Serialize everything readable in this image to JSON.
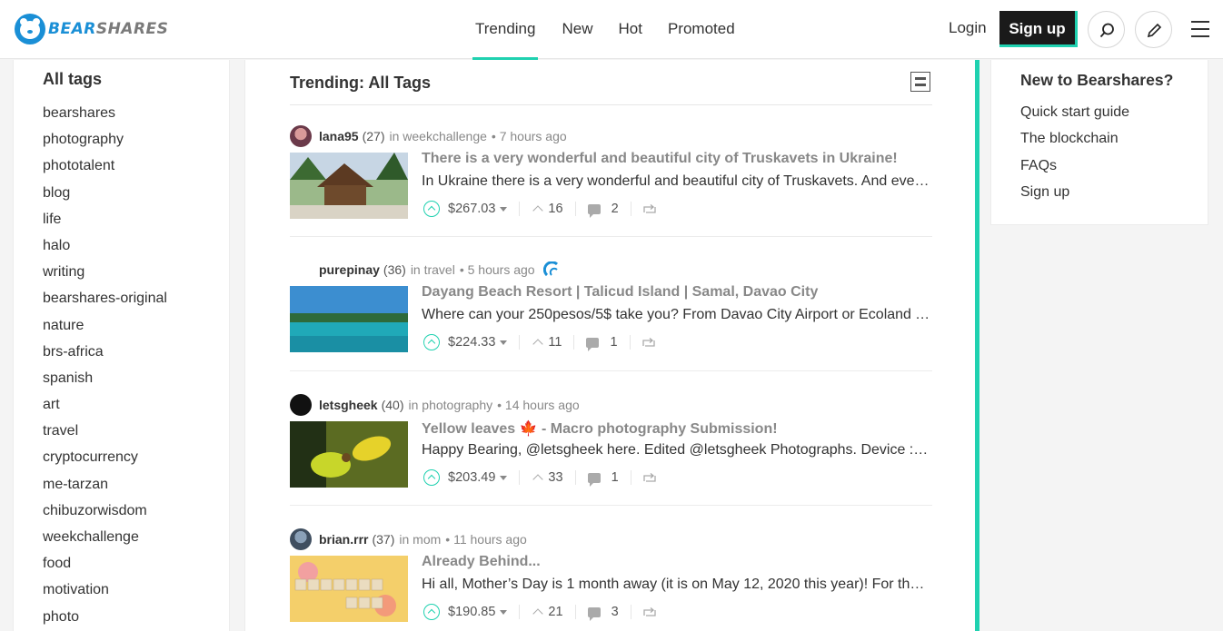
{
  "brand": {
    "part1": "BEAR",
    "part2": "SHARES",
    "color": "#1a8fd6"
  },
  "accent_color": "#1fd1b0",
  "nav": [
    {
      "label": "Trending",
      "active": true
    },
    {
      "label": "New"
    },
    {
      "label": "Hot"
    },
    {
      "label": "Promoted"
    }
  ],
  "header": {
    "login": "Login",
    "signup": "Sign up",
    "icons": [
      "search-icon",
      "pencil-icon",
      "hamburger-menu-icon"
    ]
  },
  "tags": {
    "heading": "All tags",
    "items": [
      "bearshares",
      "photography",
      "phototalent",
      "blog",
      "life",
      "halo",
      "writing",
      "bearshares-original",
      "nature",
      "brs-africa",
      "spanish",
      "art",
      "travel",
      "cryptocurrency",
      "me-tarzan",
      "chibuzorwisdom",
      "weekchallenge",
      "food",
      "motivation",
      "photo"
    ]
  },
  "feed": {
    "title": "Trending: All Tags",
    "posts": [
      {
        "author": "lana95",
        "rep": "(27)",
        "category": "in weekchallenge",
        "ago": "• 7 hours ago",
        "title": "There is a very wonderful and beautiful city of Truskavets in Ukraine!",
        "desc": "In Ukraine there is a very wonderful and beautiful city of Truskavets. And even though there are not many",
        "payout": "$267.03",
        "votes": "16",
        "comments": "2"
      },
      {
        "author": "purepinay",
        "rep": "(36)",
        "category": "in travel",
        "ago": "• 5 hours ago",
        "title": "Dayang Beach Resort | Talicud Island | Samal, Davao City",
        "desc": "Where can your 250pesos/5$ take you? From Davao City Airport or Ecoland Terminal going to the Sasa wharf",
        "payout": "$224.33",
        "votes": "11",
        "comments": "1"
      },
      {
        "author": "letsgheek",
        "rep": "(40)",
        "category": "in photography",
        "ago": "• 14 hours ago",
        "title": "Yellow leaves 🍁 - Macro photography Submission!",
        "desc": "Happy Bearing, @letsgheek here. Edited @letsgheek Photographs. Device : Samsung Galaxy and lens macro",
        "payout": "$203.49",
        "votes": "33",
        "comments": "1"
      },
      {
        "author": "brian.rrr",
        "rep": "(37)",
        "category": "in mom",
        "ago": "• 11 hours ago",
        "title": "Already Behind...",
        "desc": "Hi all, Mother’s Day is 1 month away (it is on May 12, 2020 this year)! For those who know me, you know",
        "payout": "$190.85",
        "votes": "21",
        "comments": "3"
      }
    ]
  },
  "sidebar": {
    "heading": "New to Bearshares?",
    "links": [
      "Quick start guide",
      "The blockchain",
      "FAQs",
      "Sign up"
    ]
  }
}
